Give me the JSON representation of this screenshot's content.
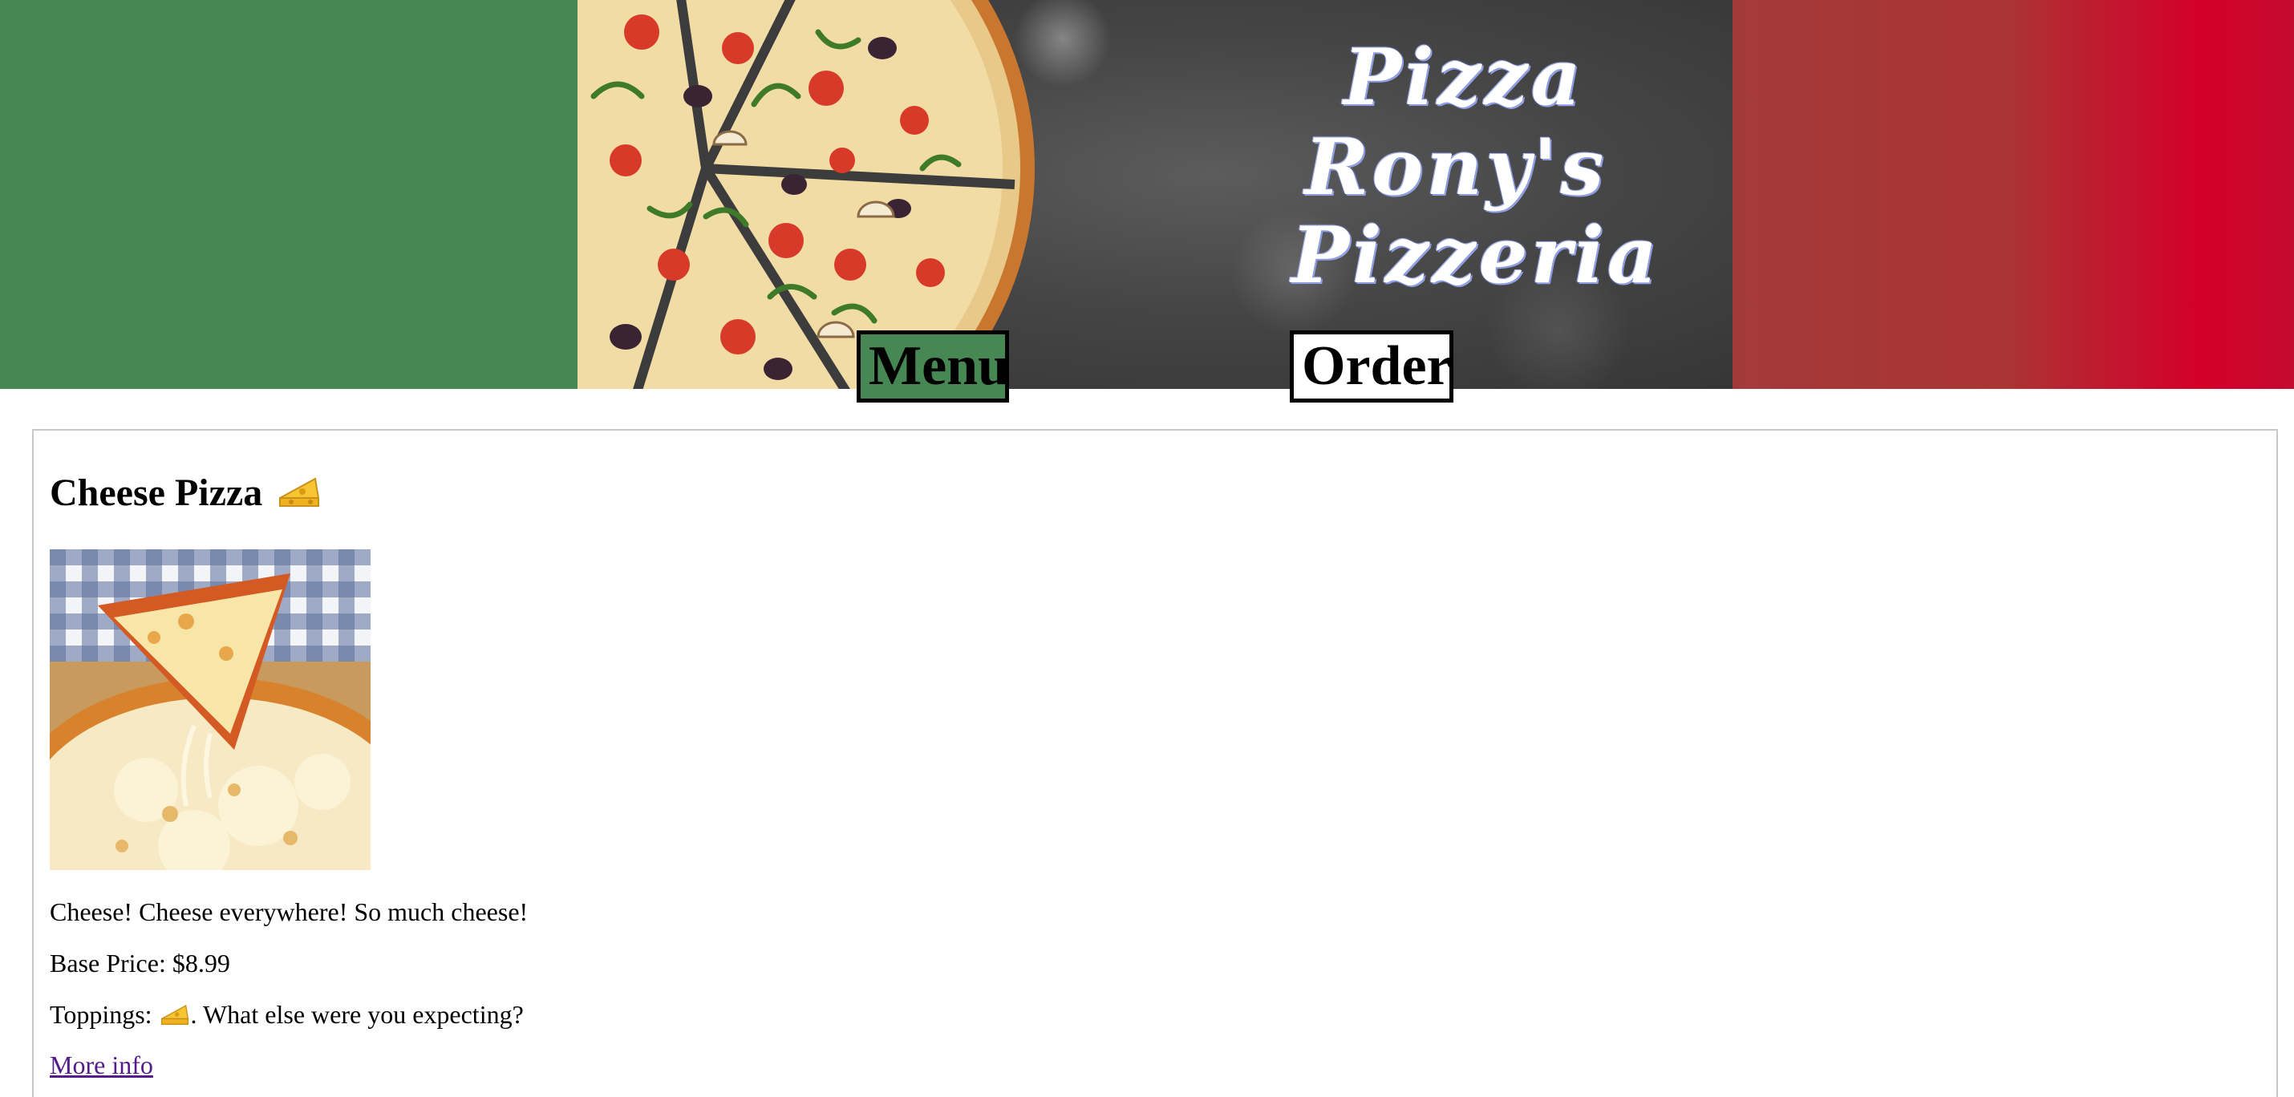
{
  "header": {
    "title_lines": [
      "Pizza",
      "Rony's",
      "Pizzeria"
    ],
    "colors": {
      "left_panel": "#468754",
      "right_panel_start": "#a33a3a",
      "right_panel_end": "#d4002a"
    }
  },
  "nav": {
    "menu_label": "Menu",
    "order_label": "Order",
    "menu_active_color": "#468754"
  },
  "item": {
    "title": "Cheese Pizza",
    "title_icon": "cheese-icon",
    "description": "Cheese! Cheese everywhere! So much cheese!",
    "price_label": "Base Price:",
    "price_value": "$8.99",
    "toppings_label": "Toppings:",
    "toppings_icon": "cheese-icon",
    "toppings_suffix": ". What else were you expecting?",
    "more_info_label": "More info",
    "link_color": "#551a8b"
  }
}
